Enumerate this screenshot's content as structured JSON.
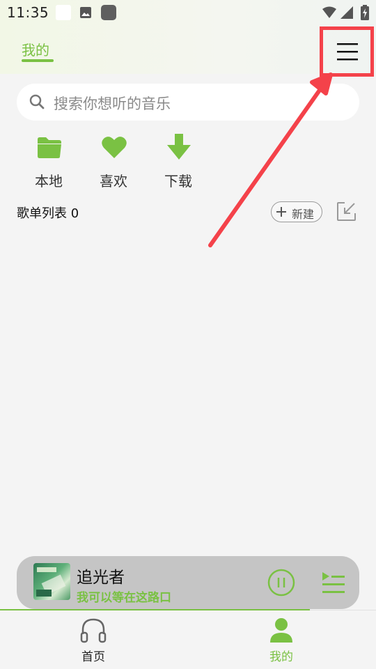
{
  "status_bar": {
    "time": "11:35"
  },
  "header": {
    "tab_mine": "我的"
  },
  "search": {
    "placeholder": "搜索你想听的音乐"
  },
  "quick_actions": [
    {
      "label": "本地",
      "icon": "folder-icon"
    },
    {
      "label": "喜欢",
      "icon": "heart-icon"
    },
    {
      "label": "下载",
      "icon": "download-icon"
    }
  ],
  "playlists": {
    "title": "歌单列表 0",
    "new_label": "新建"
  },
  "player": {
    "title": "追光者",
    "subtitle": "我可以等在这路口"
  },
  "nav": [
    {
      "label": "首页",
      "icon": "headphones-icon"
    },
    {
      "label": "我的",
      "icon": "person-icon"
    }
  ],
  "colors": {
    "accent": "#7ac143",
    "annotation": "#f4424a",
    "background": "#f4f4f4",
    "player_bg": "#c5c5c5"
  }
}
